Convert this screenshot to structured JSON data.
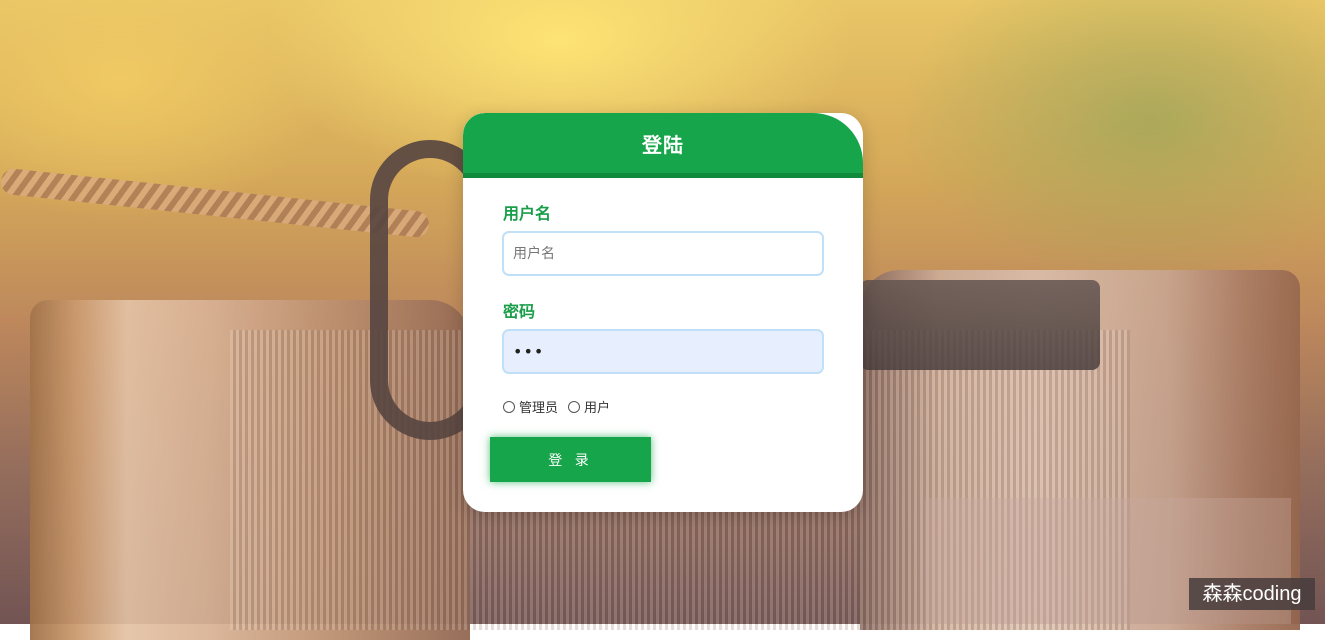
{
  "login": {
    "title": "登陆",
    "username_label": "用户名",
    "username_placeholder": "用户名",
    "password_label": "密码",
    "password_value": "•••",
    "roles": [
      {
        "label": "管理员",
        "selected": false
      },
      {
        "label": "用户",
        "selected": false
      }
    ],
    "submit_label": "登 录"
  },
  "watermark": "森森coding",
  "colors": {
    "accent": "#16a54a",
    "accent_dark": "#108a3b",
    "label": "#1a9e4a",
    "input_border": "#bfe0f6",
    "password_bg": "#e7efff"
  }
}
